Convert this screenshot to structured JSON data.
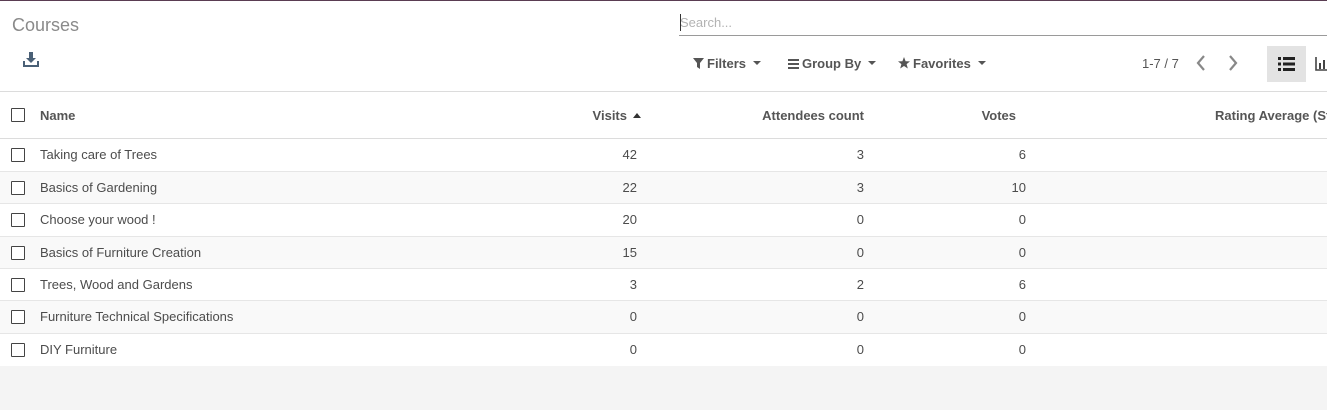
{
  "page": {
    "title": "Courses"
  },
  "search": {
    "placeholder": "Search...",
    "value": ""
  },
  "toolbar": {
    "filters_label": "Filters",
    "groupby_label": "Group By",
    "favorites_label": "Favorites",
    "pager_value": "1-7 / 7",
    "download_icon": "download-icon",
    "filter_icon": "funnel-icon",
    "groupby_icon": "bars-icon",
    "favorites_icon": "star-icon",
    "prev_icon": "chevron-left-icon",
    "next_icon": "chevron-right-icon",
    "list_view_icon": "list-view-icon",
    "graph_view_icon": "bar-chart-icon"
  },
  "table": {
    "columns": {
      "name": "Name",
      "visits": "Visits",
      "attendees": "Attendees count",
      "votes": "Votes",
      "rating": "Rating Average (Sta"
    },
    "sorted_by": "visits-ascending",
    "rows": [
      {
        "name": "Taking care of Trees",
        "visits": "42",
        "attendees": "3",
        "votes": "6"
      },
      {
        "name": "Basics of Gardening",
        "visits": "22",
        "attendees": "3",
        "votes": "10"
      },
      {
        "name": "Choose your wood !",
        "visits": "20",
        "attendees": "0",
        "votes": "0"
      },
      {
        "name": "Basics of Furniture Creation",
        "visits": "15",
        "attendees": "0",
        "votes": "0"
      },
      {
        "name": "Trees, Wood and Gardens",
        "visits": "3",
        "attendees": "2",
        "votes": "6"
      },
      {
        "name": "Furniture Technical Specifications",
        "visits": "0",
        "attendees": "0",
        "votes": "0"
      },
      {
        "name": "DIY Furniture",
        "visits": "0",
        "attendees": "0",
        "votes": "0"
      }
    ]
  },
  "colors": {
    "accent": "#5a3d52",
    "header_text": "#555555",
    "body_text": "#4c4c4c"
  }
}
